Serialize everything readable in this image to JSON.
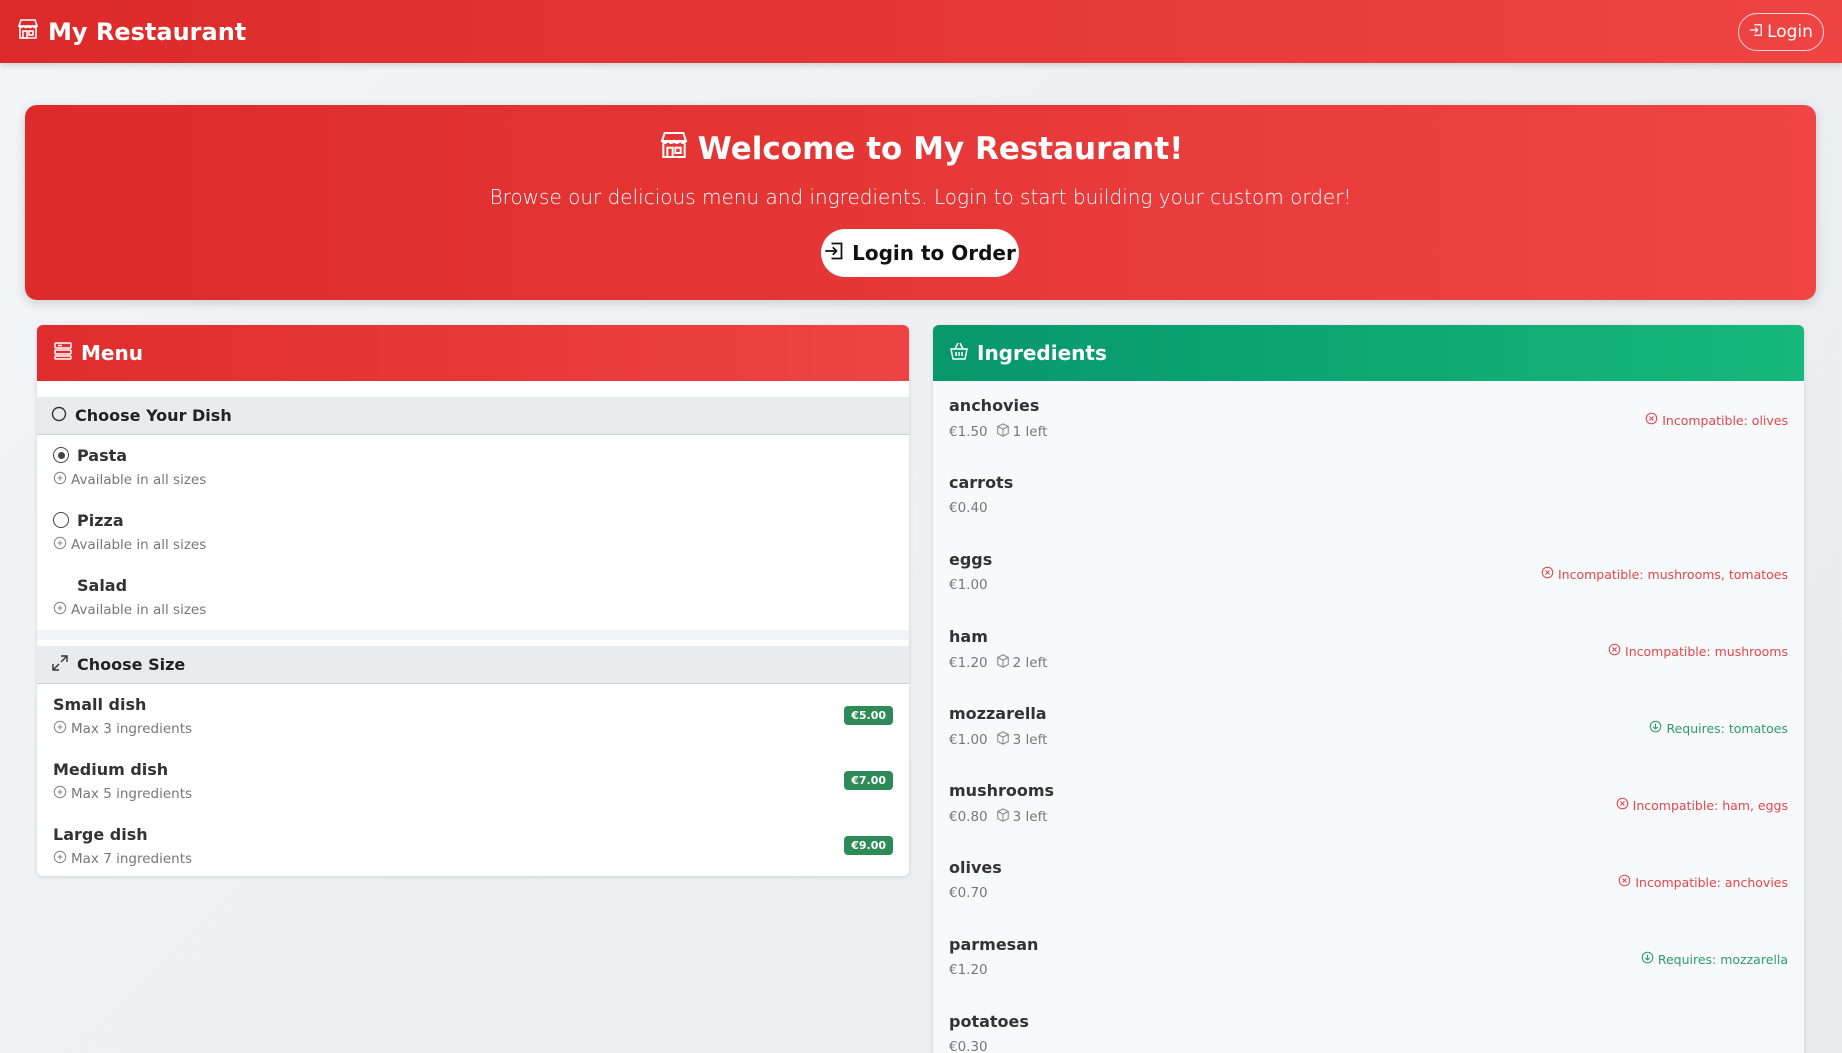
{
  "navbar": {
    "brand": "My Restaurant",
    "login_label": "Login"
  },
  "hero": {
    "title": "Welcome to My Restaurant!",
    "subtitle": "Browse our delicious menu and ingredients. Login to start building your custom order!",
    "button_label": "Login to Order"
  },
  "menu": {
    "title": "Menu",
    "dish_section": "Choose Your Dish",
    "dishes": [
      {
        "name": "Pasta",
        "note": "Available in all sizes",
        "selected": true
      },
      {
        "name": "Pizza",
        "note": "Available in all sizes",
        "selected": false
      },
      {
        "name": "Salad",
        "note": "Available in all sizes",
        "selected": false
      }
    ],
    "size_section": "Choose Size",
    "sizes": [
      {
        "name": "Small dish",
        "note": "Max 3 ingredients",
        "price": "€5.00"
      },
      {
        "name": "Medium dish",
        "note": "Max 5 ingredients",
        "price": "€7.00"
      },
      {
        "name": "Large dish",
        "note": "Max 7 ingredients",
        "price": "€9.00"
      }
    ]
  },
  "ingredients": {
    "title": "Ingredients",
    "items": [
      {
        "name": "anchovies",
        "price": "€1.50",
        "stock": "1 left",
        "note": "Incompatible: olives",
        "note_type": "bad"
      },
      {
        "name": "carrots",
        "price": "€0.40",
        "stock": "",
        "note": "",
        "note_type": ""
      },
      {
        "name": "eggs",
        "price": "€1.00",
        "stock": "",
        "note": "Incompatible: mushrooms, tomatoes",
        "note_type": "bad"
      },
      {
        "name": "ham",
        "price": "€1.20",
        "stock": "2 left",
        "note": "Incompatible: mushrooms",
        "note_type": "bad"
      },
      {
        "name": "mozzarella",
        "price": "€1.00",
        "stock": "3 left",
        "note": "Requires: tomatoes",
        "note_type": "good"
      },
      {
        "name": "mushrooms",
        "price": "€0.80",
        "stock": "3 left",
        "note": "Incompatible: ham, eggs",
        "note_type": "bad"
      },
      {
        "name": "olives",
        "price": "€0.70",
        "stock": "",
        "note": "Incompatible: anchovies",
        "note_type": "bad"
      },
      {
        "name": "parmesan",
        "price": "€1.20",
        "stock": "",
        "note": "Requires: mozzarella",
        "note_type": "good"
      },
      {
        "name": "potatoes",
        "price": "€0.30",
        "stock": "",
        "note": "",
        "note_type": ""
      }
    ]
  },
  "colors": {
    "primary": "#e03030",
    "success": "#0ea672",
    "badge": "#2e8b57",
    "incompatible": "#e0474c",
    "requires": "#2e9b6a"
  }
}
